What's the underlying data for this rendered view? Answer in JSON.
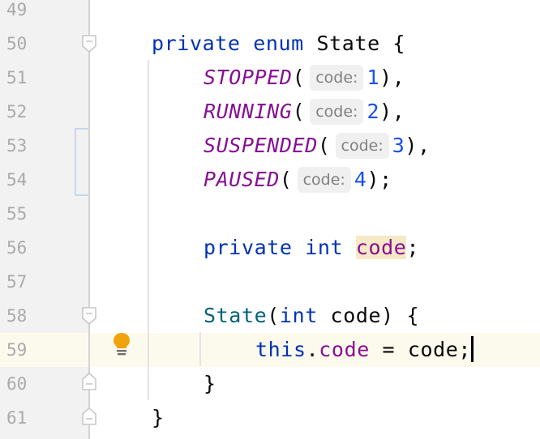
{
  "editor": {
    "current_line": 59,
    "lines": [
      {
        "num": "49"
      },
      {
        "num": "50",
        "t1": "private",
        "t2": " ",
        "t3": "enum",
        "t4": " State {"
      },
      {
        "num": "51",
        "name": "STOPPED",
        "hint": "code:",
        "value": "1",
        "end": "),"
      },
      {
        "num": "52",
        "name": "RUNNING",
        "hint": "code:",
        "value": "2",
        "end": "),"
      },
      {
        "num": "53",
        "name": "SUSPENDED",
        "hint": "code:",
        "value": "3",
        "end": "),"
      },
      {
        "num": "54",
        "name": "PAUSED",
        "hint": "code:",
        "value": "4",
        "end": ");"
      },
      {
        "num": "55"
      },
      {
        "num": "56",
        "t1": "private",
        "t2": "int",
        "field": "code",
        "end": ";"
      },
      {
        "num": "57"
      },
      {
        "num": "58",
        "ctor": "State",
        "open": "(",
        "type": "int",
        "rest": " code) {"
      },
      {
        "num": "59",
        "this": "this",
        "dot": ".",
        "field": "code",
        "rest": " = code;"
      },
      {
        "num": "60",
        "brace": "}"
      },
      {
        "num": "61",
        "brace": "}"
      }
    ],
    "open_paren": "("
  },
  "icons": {
    "intention": "lightbulb-icon",
    "fold": "fold-marker-icon"
  },
  "colors": {
    "keyword": "#0033b3",
    "enum_constant": "#871094",
    "number": "#1750eb",
    "gutter_bg": "#f2f2f2",
    "current_line_bg": "#fcfaed",
    "usage_highlight": "#f5e9c6",
    "bulb": "#f0a30a"
  }
}
